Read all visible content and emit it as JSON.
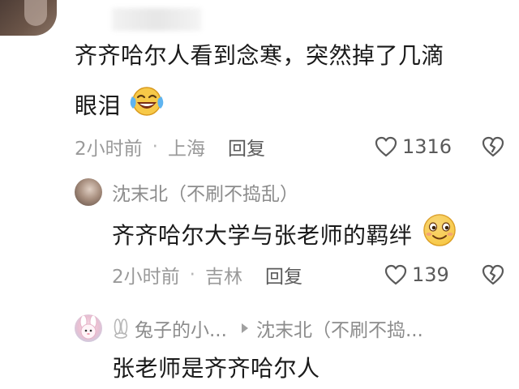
{
  "comment1": {
    "text_line1": "齐齐哈尔人看到念寒，突然掉了几滴",
    "text_line2": "眼泪",
    "emoji": "laughing-crying-emoji",
    "time": "2小时前",
    "location": "上海",
    "reply_label": "回复",
    "likes": "1316"
  },
  "reply1": {
    "username": "沈末北（不刷不捣乱）",
    "text": "齐齐哈尔大学与张老师的羁绊",
    "emoji": "smiling-emoji",
    "time": "2小时前",
    "location": "吉林",
    "reply_label": "回复",
    "likes": "139"
  },
  "reply2": {
    "username": "兔子的小...",
    "reply_to": "沈末北（不刷不捣...",
    "text": "张老师是齐齐哈尔人"
  },
  "separator_dot": "·",
  "colors": {
    "text": "#1a1a1a",
    "meta": "#9a9a9a",
    "icon": "#5a5a5a",
    "emoji_yellow": "#f7c948"
  }
}
